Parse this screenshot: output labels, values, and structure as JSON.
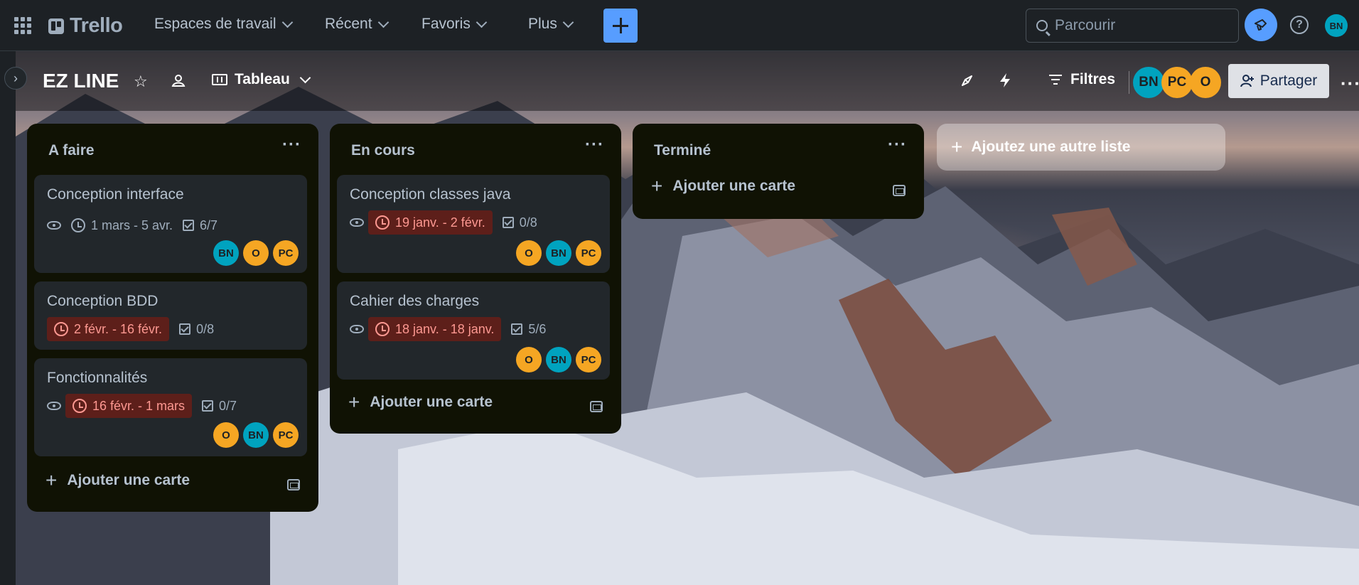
{
  "nav": {
    "logo": "Trello",
    "items": [
      {
        "label": "Espaces de travail"
      },
      {
        "label": "Récent"
      },
      {
        "label": "Favoris"
      },
      {
        "label": "Plus"
      }
    ],
    "search_placeholder": "Parcourir",
    "help_label": "?",
    "user_initials": "BN"
  },
  "board": {
    "title": "EZ LINE",
    "view": "Tableau",
    "filters_label": "Filtres",
    "members": [
      "BN",
      "PC",
      "O"
    ],
    "share_label": "Partager",
    "more": "···"
  },
  "lists": [
    {
      "title": "A faire",
      "menu": "···",
      "add_card": "Ajouter une carte",
      "cards": [
        {
          "title": "Conception interface",
          "dates": "1 mars - 5 avr.",
          "overdue": false,
          "checklist": "6/7",
          "members": [
            "BN",
            "O",
            "PC"
          ]
        },
        {
          "title": "Conception BDD",
          "dates": "2 févr. - 16 févr.",
          "overdue": true,
          "checklist": "0/8",
          "members": []
        },
        {
          "title": "Fonctionnalités",
          "dates": "16 févr. - 1 mars",
          "overdue": true,
          "checklist": "0/7",
          "members": [
            "O",
            "BN",
            "PC"
          ]
        }
      ]
    },
    {
      "title": "En cours",
      "menu": "···",
      "add_card": "Ajouter une carte",
      "cards": [
        {
          "title": "Conception classes java",
          "dates": "19 janv. - 2 févr.",
          "overdue": true,
          "checklist": "0/8",
          "members": [
            "O",
            "BN",
            "PC"
          ]
        },
        {
          "title": "Cahier des charges",
          "dates": "18 janv. - 18 janv.",
          "overdue": true,
          "checklist": "5/6",
          "members": [
            "O",
            "BN",
            "PC"
          ]
        }
      ]
    },
    {
      "title": "Terminé",
      "menu": "···",
      "add_card": "Ajouter une carte",
      "cards": []
    }
  ],
  "add_list": "Ajoutez une autre liste",
  "colors": {
    "accent": "#579dff",
    "overdue_bg": "#5d1f1a",
    "overdue_text": "#fd9891",
    "member_bn": "#00a3bf",
    "member_orange": "#f5a623"
  }
}
